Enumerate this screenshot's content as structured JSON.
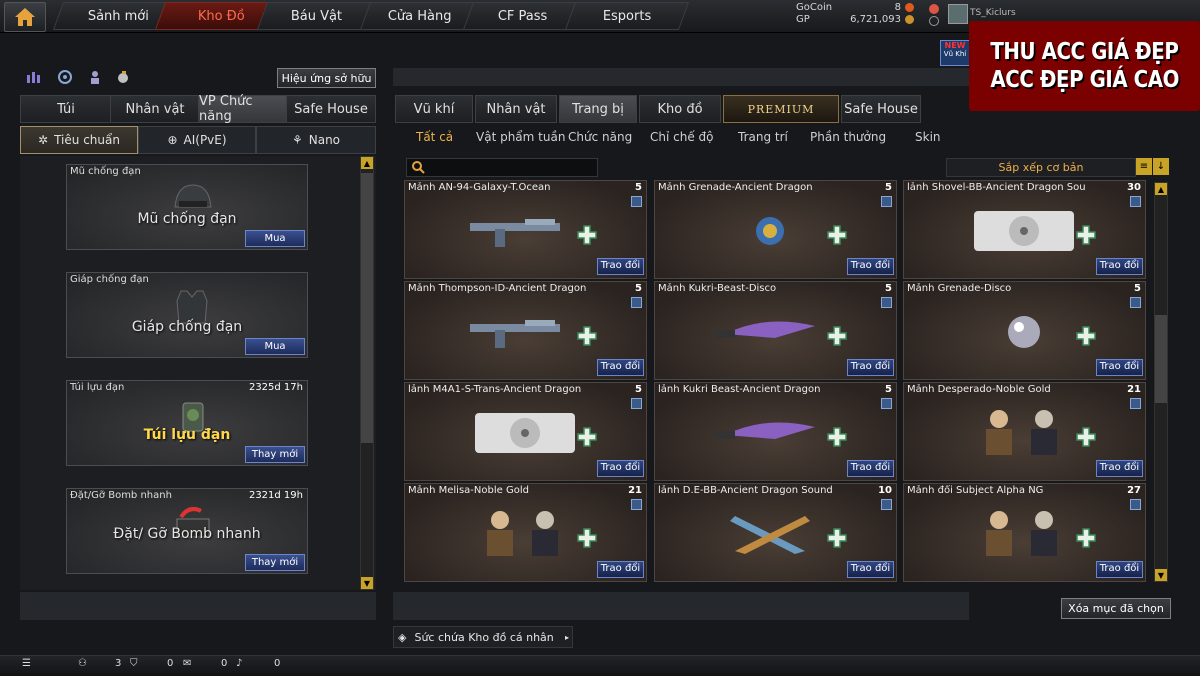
{
  "nav": {
    "tabs": [
      "Sảnh mới",
      "Kho Đồ",
      "Báu Vật",
      "Cửa Hàng",
      "CF Pass",
      "Esports"
    ],
    "active": "Kho Đồ"
  },
  "currency": {
    "gocoin_label": "GoCoin",
    "gocoin_value": "8",
    "gp_label": "GP",
    "gp_value": "6,721,093"
  },
  "user": {
    "name": "TS_Kiclurs"
  },
  "banner": {
    "line1": "THU ACC GIÁ ĐẸP",
    "line2": "ACC ĐẸP GIÁ CAO"
  },
  "new_badge": {
    "top": "NEW",
    "bottom": "Vũ Khí"
  },
  "left": {
    "effect_button": "Hiệu ứng sở hữu",
    "tabs": [
      "Túi",
      "Nhân vật",
      "VP Chức năng",
      "Safe House"
    ],
    "subtabs": [
      "Tiêu chuẩn",
      "AI(PvE)",
      "Nano"
    ],
    "items": [
      {
        "title": "Mũ chống đạn",
        "time": "",
        "name": "Mũ chống đạn",
        "button": "Mua"
      },
      {
        "title": "Giáp chống đạn",
        "time": "",
        "name": "Giáp chống đạn",
        "button": "Mua"
      },
      {
        "title": "Túi lựu đạn",
        "time": "2325d 17h",
        "name": "Túi lựu đạn",
        "button": "Thay mới"
      },
      {
        "title": "Đặt/Gỡ Bomb nhanh",
        "time": "2321d 19h",
        "name": "Đặt/ Gỡ Bomb nhanh",
        "button": "Thay mới"
      }
    ]
  },
  "right": {
    "tabs": [
      "Vũ khí",
      "Nhân vật",
      "Trang bị",
      "Kho đồ",
      "PREMIUM",
      "Safe House"
    ],
    "filters": [
      "Tất cả",
      "Vật phẩm tuần",
      "Chức năng",
      "Chỉ chế độ",
      "Trang trí",
      "Phần thưởng",
      "Skin"
    ],
    "sort_label": "Sắp xếp cơ bản",
    "search_placeholder": "",
    "items": [
      {
        "name": "Mảnh AN-94-Galaxy-T.Ocean",
        "count": "5",
        "button": "Trao đổi"
      },
      {
        "name": "Mảnh Grenade-Ancient Dragon",
        "count": "5",
        "button": "Trao đổi"
      },
      {
        "name": "lảnh Shovel-BB-Ancient Dragon Sou",
        "count": "30",
        "button": "Trao đổi"
      },
      {
        "name": "Mảnh Thompson-ID-Ancient Dragon",
        "count": "5",
        "button": "Trao đổi"
      },
      {
        "name": "Mảnh Kukri-Beast-Disco",
        "count": "5",
        "button": "Trao đổi"
      },
      {
        "name": "Mảnh Grenade-Disco",
        "count": "5",
        "button": "Trao đổi"
      },
      {
        "name": "lảnh M4A1-S-Trans-Ancient Dragon",
        "count": "5",
        "button": "Trao đổi"
      },
      {
        "name": "lảnh Kukri Beast-Ancient Dragon",
        "count": "5",
        "button": "Trao đổi"
      },
      {
        "name": "Mảnh Desperado-Noble Gold",
        "count": "21",
        "button": "Trao đổi"
      },
      {
        "name": "Mảnh Melisa-Noble Gold",
        "count": "21",
        "button": "Trao đổi"
      },
      {
        "name": "lảnh D.E-BB-Ancient Dragon Sound",
        "count": "10",
        "button": "Trao đổi"
      },
      {
        "name": "Mảnh đổi Subject Alpha NG",
        "count": "27",
        "button": "Trao đổi"
      }
    ],
    "clear_button": "Xóa mục đã chọn",
    "capacity_label": "Sức chứa Kho đồ cá nhân"
  },
  "status": {
    "a": "3",
    "b": "0",
    "c": "0",
    "d": "0"
  }
}
